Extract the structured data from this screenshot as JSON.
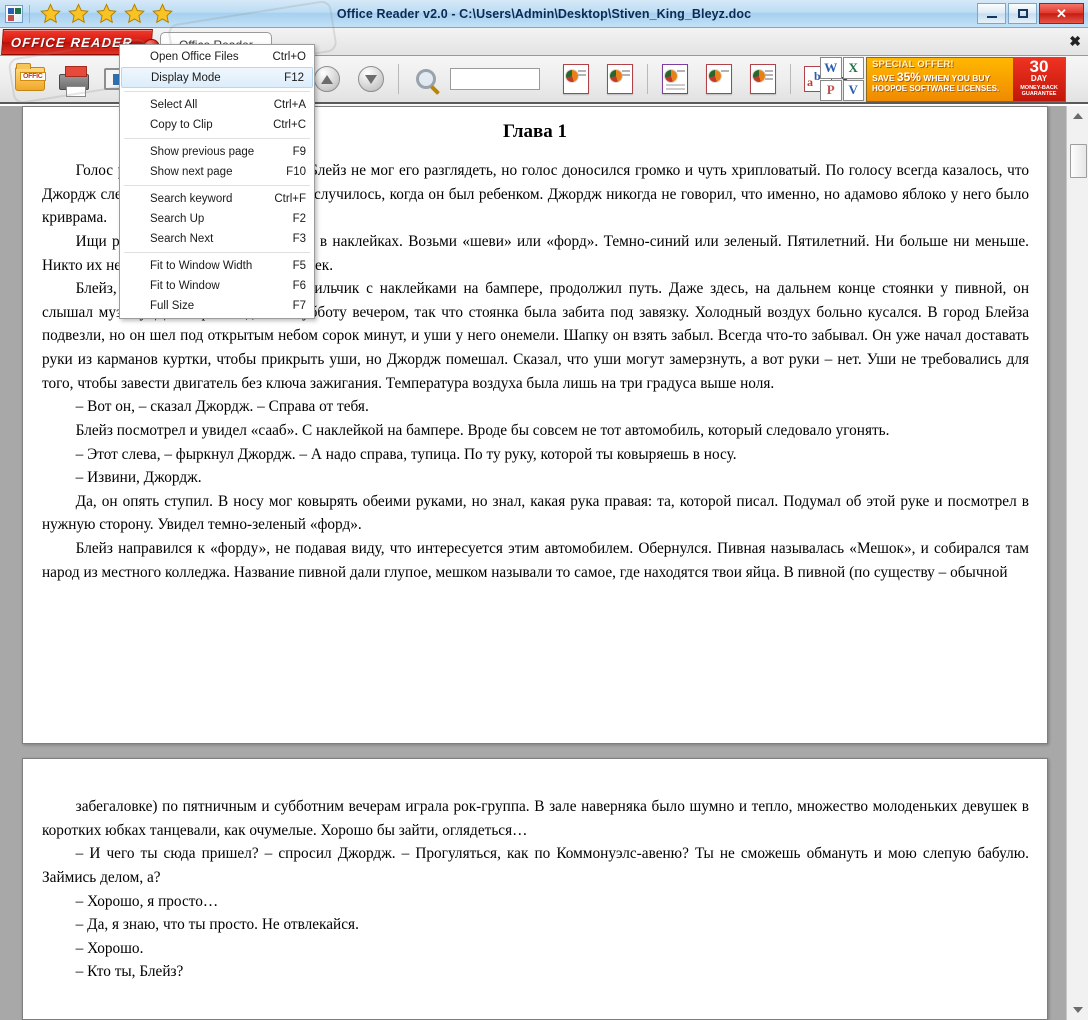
{
  "window": {
    "title": "Office Reader v2.0 - C:\\Users\\Admin\\Desktop\\Stiven_King_Bleyz.doc",
    "app_icon": "office-app-icon",
    "rating_stars": 5,
    "minimize_label": "–",
    "maximize_label": "□",
    "close_label": "✕"
  },
  "tabstrip": {
    "brand_label": "OFFICE READER",
    "brand_caret_icon": "chevron-down-icon",
    "tab_label": "Office Reader",
    "tab_close_label": "✖"
  },
  "toolbar": {
    "buttons": [
      {
        "name": "open-office-files",
        "icon": "folder-office-icon"
      },
      {
        "name": "print",
        "icon": "printer-icon"
      },
      {
        "name": "display-mode",
        "icon": "monitor-icon"
      },
      {
        "name": "copy-to-clip",
        "icon": "document-copy-icon"
      },
      {
        "name": "document-notes",
        "icon": "document-notes-icon"
      },
      {
        "name": "document-select",
        "icon": "document-cursor-icon"
      },
      {
        "name": "show-previous-page",
        "icon": "arrow-up-icon"
      },
      {
        "name": "show-next-page",
        "icon": "arrow-down-icon"
      },
      {
        "name": "search-keyword",
        "icon": "magnifier-icon"
      },
      {
        "name": "search-up",
        "icon": "search-up-icon"
      },
      {
        "name": "search-next",
        "icon": "search-next-icon"
      },
      {
        "name": "fit-to-window-width",
        "icon": "fit-width-icon"
      },
      {
        "name": "fit-to-window",
        "icon": "fit-window-icon"
      },
      {
        "name": "full-size",
        "icon": "full-size-icon"
      },
      {
        "name": "language",
        "icon": "abc-icon"
      },
      {
        "name": "web",
        "icon": "globe-icon"
      }
    ],
    "search_value": "",
    "search_placeholder": ""
  },
  "advert": {
    "headline": "SPECIAL OFFER!",
    "line2_prefix": "SAVE",
    "line2_percent": "35%",
    "line2_suffix": "WHEN YOU BUY",
    "line3": "HOOPOE SOFTWARE LICENSES.",
    "badge_number": "30",
    "badge_unit": "DAY",
    "badge_note": "MONEY-BACK GUARANTEE",
    "office_tiles": [
      "W",
      "X",
      "P",
      "V"
    ]
  },
  "context_menu": {
    "selected_item": "Display Mode",
    "groups": [
      [
        {
          "label": "Open Office Files",
          "accel": "Ctrl+O",
          "selected": false
        },
        {
          "label": "Display Mode",
          "accel": "F12",
          "selected": true
        }
      ],
      [
        {
          "label": "Select All",
          "accel": "Ctrl+A",
          "selected": false
        },
        {
          "label": "Copy to Clip",
          "accel": "Ctrl+C",
          "selected": false
        }
      ],
      [
        {
          "label": "Show previous page",
          "accel": "F9",
          "selected": false
        },
        {
          "label": "Show next page",
          "accel": "F10",
          "selected": false
        }
      ],
      [
        {
          "label": "Search keyword",
          "accel": "Ctrl+F",
          "selected": false
        },
        {
          "label": "Search Up",
          "accel": "F2",
          "selected": false
        },
        {
          "label": "Search Next",
          "accel": "F3",
          "selected": false
        }
      ],
      [
        {
          "label": "Fit to Window Width",
          "accel": "F5",
          "selected": false
        },
        {
          "label": "Fit to Window",
          "accel": "F6",
          "selected": false
        },
        {
          "label": "Full Size",
          "accel": "F7",
          "selected": false
        }
      ]
    ]
  },
  "document": {
    "heading": "Глава 1",
    "page1_paragraphs": [
      "Голос раздавался где-то в темноте. Блейз не мог его разглядеть, но голос доносился громко и чуть хрипловатый. По голосу всегда казалось, что Джордж слегка простужен. Что-то с ним случилось, когда он был ребенком. Джордж никогда не говорил, что именно, но адамово яблоко у него было криврама.",
      "Ищи развалюху, у него весь бампер в наклейках. Возьми «шеви» или «форд». Темно-синий или зеленый. Пятилетний. Ни больше ни меньше. Никто их не запоминает. И никаких наклеек.",
      "Блейз, миновав маленький автомобильчик с наклейками на бампере, продолжил путь. Даже здесь, на дальнем конце стоянки у пивной, он слышал музыку. Дело происходило в субботу вечером, так что стоянка была забита под завязку. Холодный воздух больно кусался. В город Блейза подвезли, но он шел под открытым небом сорок минут, и уши у него онемели. Шапку он взять забыл. Всегда что-то забывал. Он уже начал доставать руки из карманов куртки, чтобы прикрыть уши, но Джордж помешал. Сказал, что уши могут замерзнуть, а вот руки – нет. Уши не требовались для того, чтобы завести двигатель без ключа зажигания. Температура воздуха была лишь на три градуса выше ноля.",
      "– Вот он, – сказал Джордж. – Справа от тебя.",
      "Блейз посмотрел и увидел «сааб». С наклейкой на бампере. Вроде бы совсем не тот автомобиль, который следовало угонять.",
      "– Этот слева, – фыркнул Джордж. – А надо справа, тупица. По ту руку, которой ты ковыряешь в носу.",
      "– Извини, Джордж.",
      "Да, он опять ступил. В носу мог ковырять обеими руками, но знал, какая рука правая: та, которой писал. Подумал об этой руке и посмотрел в нужную сторону. Увидел темно-зеленый «форд».",
      "Блейз направился к «форду», не подавая виду, что интересуется этим автомобилем. Обернулся. Пивная называлась «Мешок», и собирался там народ из местного колледжа. Название пивной дали глупое, мешком называли то самое, где находятся твои яйца. В пивной (по существу – обычной"
    ],
    "page2_paragraphs": [
      "забегаловке) по пятничным и субботним вечерам играла рок-группа. В зале наверняка было шумно и тепло, множество молоденьких девушек в коротких юбках танцевали, как очумелые. Хорошо бы зайти, оглядеться…",
      "– И чего ты сюда пришел? – спросил Джордж. – Прогуляться, как по Коммонуэлс-авеню? Ты не сможешь обмануть и мою слепую бабулю. Займись делом, а?",
      "– Хорошо, я просто…",
      "– Да, я знаю, что ты просто. Не отвлекайся.",
      "– Хорошо.",
      "– Кто ты, Блейз?"
    ]
  },
  "scrollbar": {
    "up_icon": "scroll-up-icon",
    "down_icon": "scroll-down-icon",
    "thumb": "scroll-thumb"
  },
  "colors": {
    "brand_red": "#d6160c",
    "titlebar_blue": "#a6d0ef",
    "ad_orange": "#f08a00",
    "workspace_gray": "#a8a8a8",
    "selection_blue": "#dcedfb"
  }
}
